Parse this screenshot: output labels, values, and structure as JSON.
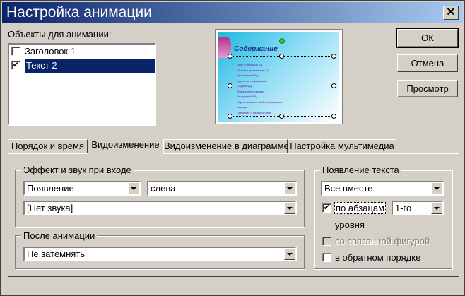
{
  "dialog": {
    "title": "Настройка анимации",
    "close_glyph": "✕"
  },
  "objects": {
    "label": "Объекты для анимации:",
    "items": [
      {
        "label": "Заголовок 1",
        "checked": false
      },
      {
        "label": "Текст 2",
        "checked": true,
        "selected": true
      }
    ]
  },
  "preview": {
    "slide_title": "Содержание",
    "slide_lines": [
      "Цель и функции БД",
      "Области применения БД",
      "Достоинства БД",
      "Хранение информации",
      "Служба БД",
      "Анализ информации",
      "Интерфейс БД",
      "Подготовка итоговой информации",
      "Выводы",
      "Сведения о разработчике"
    ]
  },
  "buttons": {
    "ok": "ОК",
    "cancel": "Отмена",
    "preview": "Просмотр"
  },
  "tabs": [
    {
      "label": "Порядок и время",
      "active": false
    },
    {
      "label": "Видоизменение",
      "active": true
    },
    {
      "label": "Видоизменение в диаграмме",
      "active": false
    },
    {
      "label": "Настройка мультимедиа",
      "active": false
    }
  ],
  "entry_effect": {
    "group_title": "Эффект и звук при входе",
    "effect_value": "Появление",
    "direction_value": "слева",
    "sound_value": "[Нет звука]"
  },
  "after_animation": {
    "group_title": "После анимации",
    "value": "Не затемнять"
  },
  "text_appearance": {
    "group_title": "Появление текста",
    "mode_value": "Все вместе",
    "by_paragraph_label": "по абзацам",
    "by_paragraph_checked": true,
    "level_value": "1-го",
    "level_suffix": "уровня",
    "attached_shape_label": "со связанной фигурой",
    "attached_shape_checked": false,
    "reverse_label": "в обратном порядке",
    "reverse_checked": false
  }
}
